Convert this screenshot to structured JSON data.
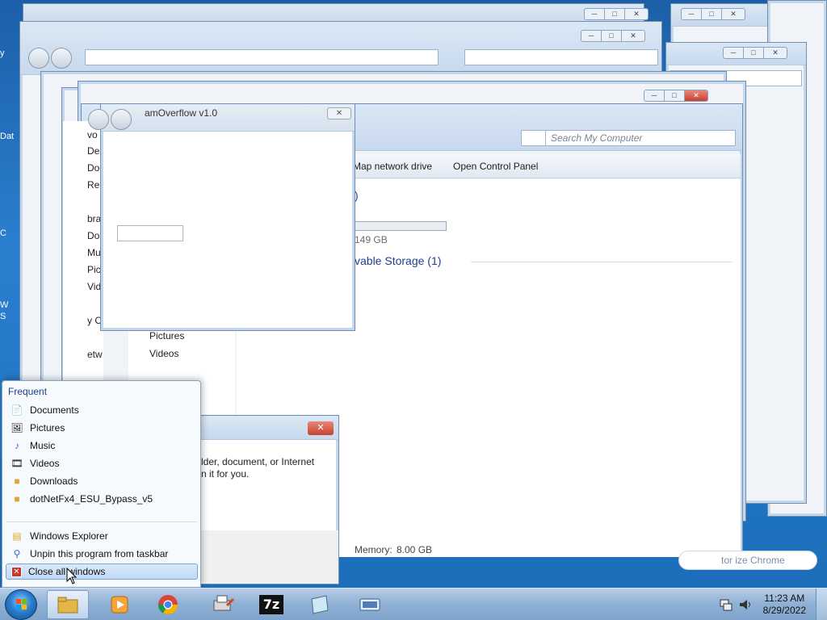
{
  "desktop": {
    "fragments": [
      "y",
      "Dat",
      "C",
      "W",
      "S"
    ]
  },
  "computer_window": {
    "search_placeholder": "Search My Computer",
    "commands": [
      "Map network drive",
      "Open Control Panel"
    ],
    "drive_free": "149 GB",
    "section_removable": "vable Storage (1)",
    "section_hdd_suffix": ")",
    "memory_label": "Memory:",
    "memory_value": "8.00 GB",
    "sidebar_fragments": [
      "vo",
      "Des",
      "Do",
      "Rec",
      "bra",
      "Do",
      "Mu",
      "Pic",
      "Vid",
      "y C",
      "etw"
    ],
    "sidebar_lib": [
      "Pictures",
      "Videos"
    ]
  },
  "overflow_window": {
    "title": "amOverflow v1.0"
  },
  "run_dialog": {
    "text_line1": "lder, document, or Internet",
    "text_line2": "n it for you."
  },
  "chrome_fragment": "tor  ize Chrome",
  "jumplist": {
    "header": "Frequent",
    "items": [
      {
        "label": "Documents",
        "icon": "document-icon"
      },
      {
        "label": "Pictures",
        "icon": "pictures-icon"
      },
      {
        "label": "Music",
        "icon": "music-icon"
      },
      {
        "label": "Videos",
        "icon": "videos-icon"
      },
      {
        "label": "Downloads",
        "icon": "folder-icon"
      },
      {
        "label": "dotNetFx4_ESU_Bypass_v5",
        "icon": "folder-icon"
      }
    ],
    "tasks": [
      {
        "label": "Windows Explorer",
        "icon": "explorer-icon"
      },
      {
        "label": "Unpin this program from taskbar",
        "icon": "unpin-icon"
      },
      {
        "label": "Close all windows",
        "icon": "close-icon"
      }
    ]
  },
  "taskbar": {
    "clock_time": "11:23 AM",
    "clock_date": "8/29/2022",
    "pinned": [
      "explorer",
      "media-player",
      "chrome",
      "printer-tool",
      "7zip",
      "notepad",
      "app"
    ]
  }
}
